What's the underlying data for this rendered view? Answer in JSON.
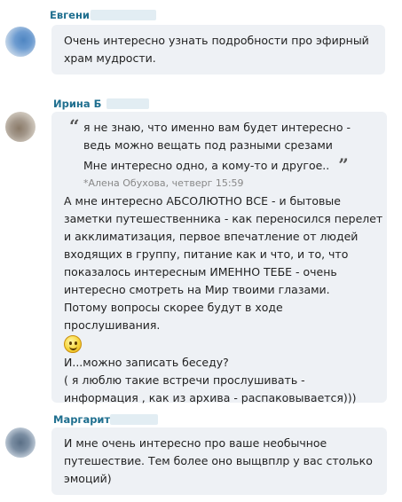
{
  "messages": [
    {
      "author": "Евгений",
      "avatar_icon": "user-avatar",
      "lines": [
        "Очень интересно узнать подробности про эфирный",
        "храм мудрости."
      ]
    },
    {
      "author": "Ирина Б",
      "avatar_icon": "user-avatar",
      "quote": {
        "lines": [
          "я не знаю, что именно вам будет интересно -",
          "ведь можно вещать под разными срезами",
          "Мне интересно одно, а кому-то и другое.."
        ],
        "attribution": "*Алена Обухова, четверг 15:59",
        "open_mark": "“",
        "close_mark": "”"
      },
      "lines": [
        "А мне интересно АБСОЛЮТНО ВСЕ - и бытовые",
        "заметки путешественника - как переносился перелет",
        "и акклиматизация, первое впечатление от людей",
        "входящих в группу, питание как и что, и то, что",
        "показалось интересным ИМЕННО ТЕБЕ - очень",
        "интересно смотреть на Мир твоими глазами.",
        "Потому вопросы скорее будут в ходе",
        "прослушивания."
      ],
      "emoji": "smile-emoji",
      "lines_after": [
        "И...можно записать беседу?",
        "( я люблю  такие встречи прослушивать -",
        "информация , как из архива - распаковывается)))"
      ]
    },
    {
      "author": "Маргарита",
      "avatar_icon": "user-avatar",
      "lines": [
        "И мне очень интересно про ваше необычное",
        "путешествие. Тем более оно выщвплр у вас столько",
        "эмоций)"
      ]
    }
  ]
}
